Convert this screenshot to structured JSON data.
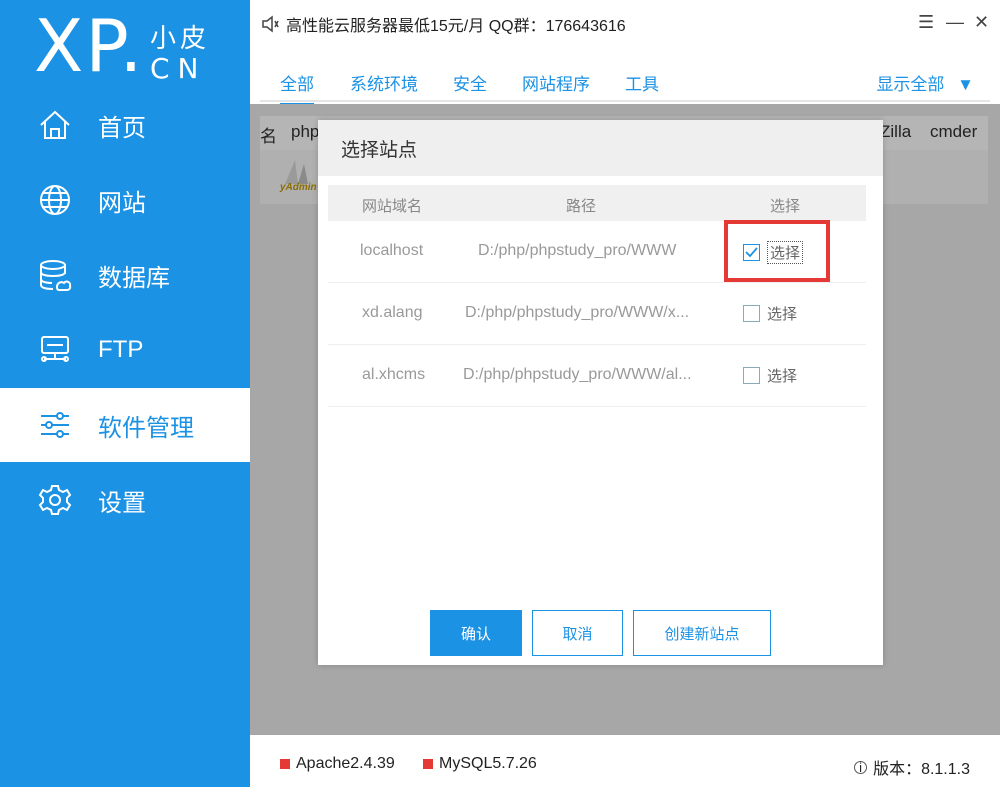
{
  "logo": {
    "main": "XP.",
    "top": "小皮",
    "bottom": "CN"
  },
  "sidebar": {
    "items": [
      {
        "label": "首页",
        "icon": "home-icon"
      },
      {
        "label": "网站",
        "icon": "globe-icon"
      },
      {
        "label": "数据库",
        "icon": "database-icon"
      },
      {
        "label": "FTP",
        "icon": "ftp-icon"
      },
      {
        "label": "软件管理",
        "icon": "sliders-icon",
        "active": true
      },
      {
        "label": "设置",
        "icon": "gear-icon"
      }
    ]
  },
  "titlebar": {
    "text": "高性能云服务器最低15元/月  QQ群：176643616"
  },
  "tabs": [
    "全部",
    "系统环境",
    "安全",
    "网站程序",
    "工具"
  ],
  "show_all": "显示全部",
  "background": {
    "col_left": "名",
    "col_php": "php",
    "col_zilla": "Zilla",
    "col_cmder": "cmder",
    "icon_text": "yAdmin"
  },
  "modal": {
    "title": "选择站点",
    "headers": {
      "domain": "网站域名",
      "path": "路径",
      "select": "选择"
    },
    "rows": [
      {
        "domain": "localhost",
        "path": "D:/php/phpstudy_pro/WWW",
        "select": "选择",
        "checked": true
      },
      {
        "domain": "xd.alang",
        "path": "D:/php/phpstudy_pro/WWW/x...",
        "select": "选择",
        "checked": false
      },
      {
        "domain": "al.xhcms",
        "path": "D:/php/phpstudy_pro/WWW/al...",
        "select": "选择",
        "checked": false
      }
    ],
    "buttons": {
      "confirm": "确认",
      "cancel": "取消",
      "create": "创建新站点"
    }
  },
  "footer": {
    "apache": "Apache2.4.39",
    "mysql": "MySQL5.7.26",
    "version": "版本：8.1.1.3"
  },
  "colors": {
    "accent": "#1c92e4",
    "status_red": "#e53935",
    "highlight": "#e53935"
  }
}
